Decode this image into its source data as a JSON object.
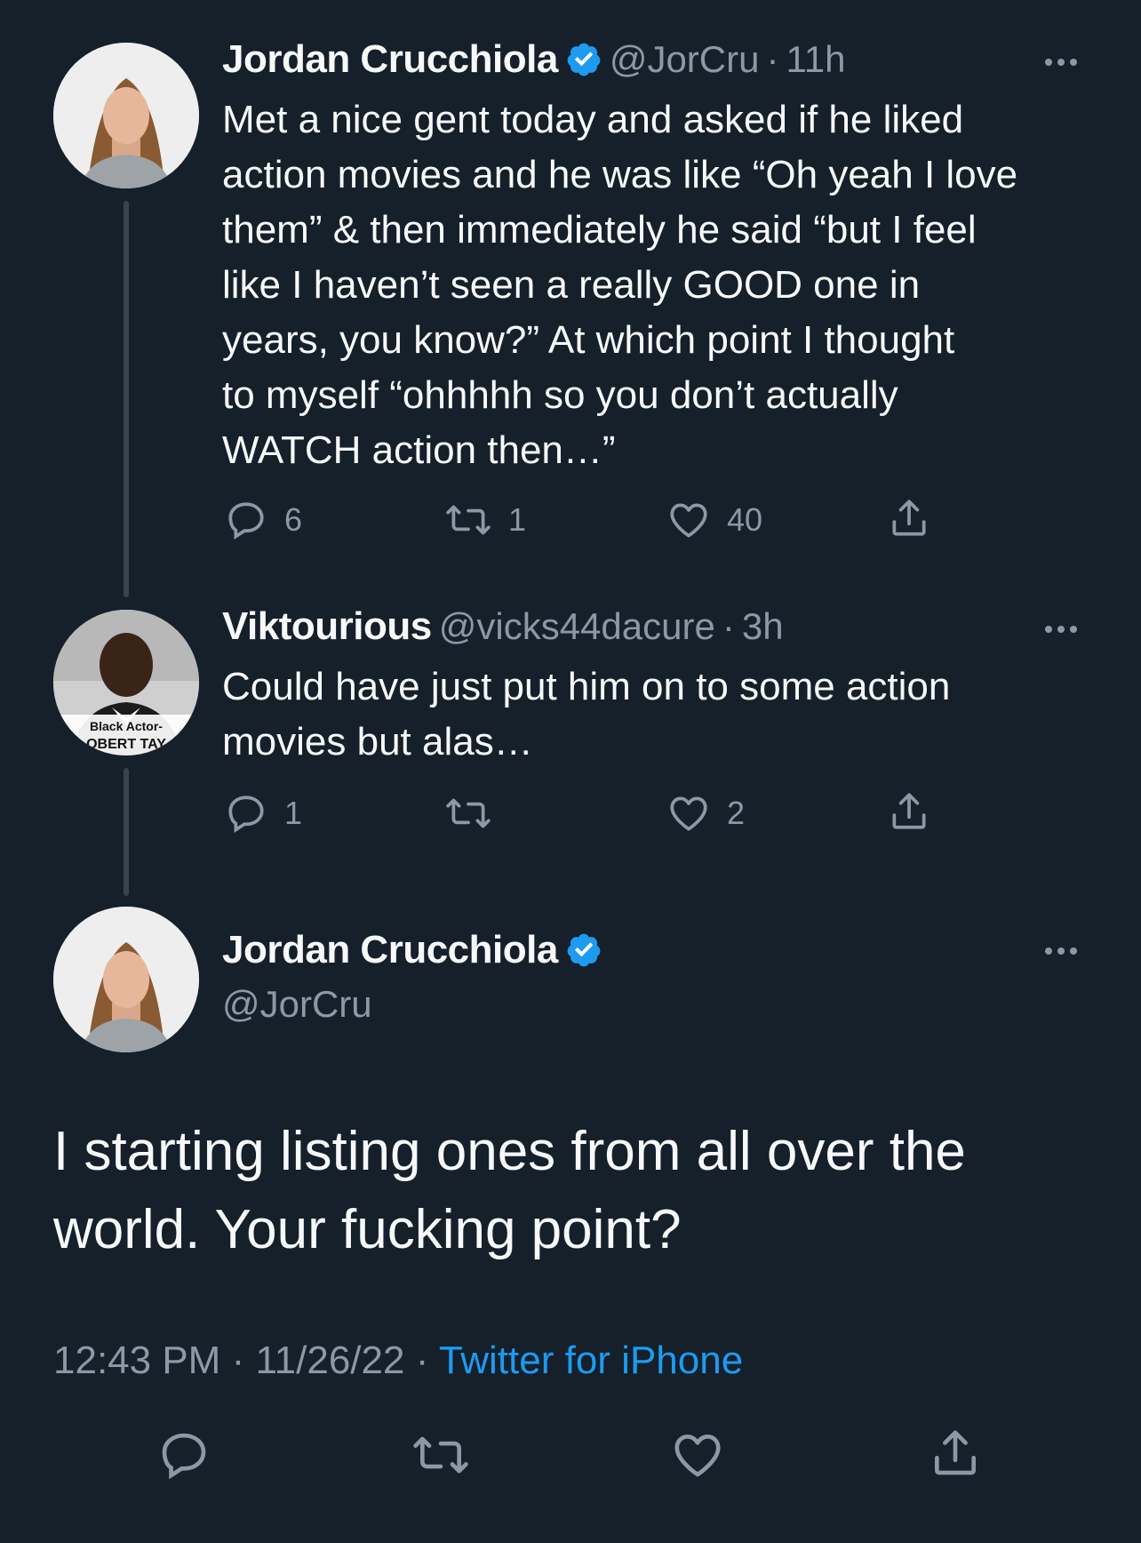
{
  "tweets": [
    {
      "name": "Jordan Crucchiola",
      "handle": "@JorCru",
      "sep": "·",
      "time": "11h",
      "text": "Met a nice gent today and asked if he liked\naction movies and he was like “Oh yeah I love\nthem” & then immediately he said “but I feel\nlike I haven’t seen a really GOOD one in\nyears, you know?” At which point I thought\nto myself “ohhhhh so you don’t actually\nWATCH action then…”",
      "replies": "6",
      "retweets": "1",
      "likes": "40"
    },
    {
      "name": "Viktourious",
      "handle": "@vicks44dacure",
      "sep": "·",
      "time": "3h",
      "avatar_caption_1": "Black Actor-",
      "avatar_caption_2": "OBERT TAY",
      "text": "Could have just put him on to some action\nmovies but alas…",
      "replies": "1",
      "retweets": "",
      "likes": "2"
    }
  ],
  "main_tweet": {
    "name": "Jordan Crucchiola",
    "handle": "@JorCru",
    "text": "I starting listing ones from all over the\nworld. Your fucking point?",
    "time": "12:43 PM",
    "date": "11/26/22",
    "sep": "·",
    "source": "Twitter for iPhone"
  },
  "colors": {
    "background": "#15202b",
    "accent": "#1d9bf0",
    "muted": "#8b98a5",
    "text": "#f7f9f9"
  },
  "icons": [
    "verified-badge-icon",
    "more-icon",
    "reply-icon",
    "retweet-icon",
    "like-icon",
    "share-icon"
  ]
}
